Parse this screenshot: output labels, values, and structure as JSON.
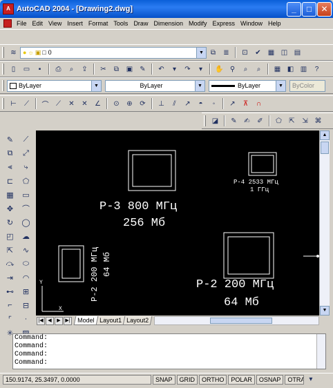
{
  "window": {
    "title": "AutoCAD 2004 - [Drawing2.dwg]",
    "btn_min": "_",
    "btn_max": "□",
    "btn_close": "✕"
  },
  "menu": [
    "File",
    "Edit",
    "View",
    "Insert",
    "Format",
    "Tools",
    "Draw",
    "Dimension",
    "Modify",
    "Express",
    "Window",
    "Help"
  ],
  "layer_combo": {
    "value": "0"
  },
  "properties": {
    "color": "ByLayer",
    "linetype": "ByLayer",
    "lineweight": "ByLayer",
    "plotstyle": "ByColor"
  },
  "drawing": {
    "labels": [
      {
        "line1": "P-3 800 МГц",
        "line2": "256 Мб"
      },
      {
        "line1": "P-4 2533 МГц",
        "line2": "1 ГГц"
      },
      {
        "line1": "P-2 200 МГц",
        "line2": "64 Мб"
      },
      {
        "line1": "P-2 200 МГц",
        "line2": "64 Мб"
      }
    ],
    "ucs_y": "Y",
    "ucs_x": "X"
  },
  "tabs": [
    "Model",
    "Layout1",
    "Layout2"
  ],
  "command_lines": [
    "Command:",
    "Command:",
    "Command:",
    "Command:"
  ],
  "status": {
    "coords": "150.9174, 25.3497, 0.0000",
    "buttons": [
      "SNAP",
      "GRID",
      "ORTHO",
      "POLAR",
      "OSNAP",
      "OTRACK"
    ]
  }
}
